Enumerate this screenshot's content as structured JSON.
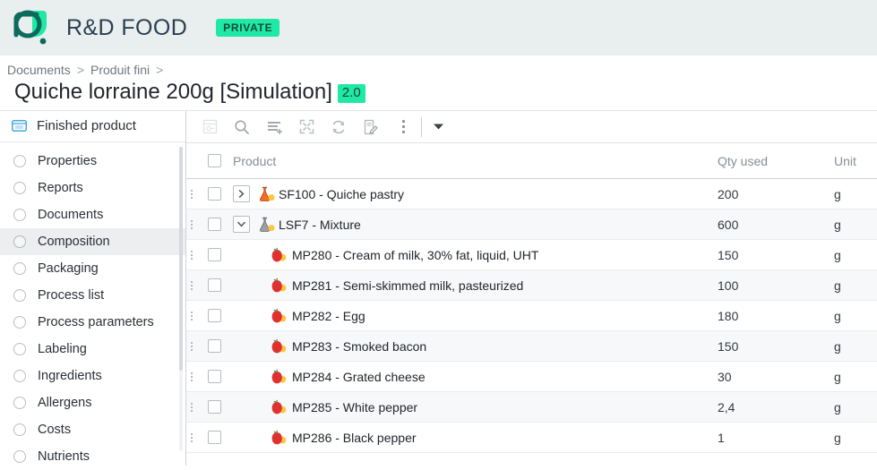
{
  "app": {
    "logo_icon": "leaf-circle-logo",
    "title": "R&D FOOD",
    "privacy_badge": "PRIVATE",
    "brand_color": "#1fe9a4",
    "topbar_bg": "#e9eeee"
  },
  "breadcrumb": {
    "items": [
      "Documents",
      "Produit fini"
    ],
    "separator": ">",
    "trailing_separator": ">"
  },
  "page": {
    "title": "Quiche lorraine 200g [Simulation]",
    "version_badge": "2.0"
  },
  "sidebar": {
    "header": {
      "icon": "folder-icon",
      "label": "Finished product"
    },
    "items": [
      {
        "label": "Properties",
        "active": false
      },
      {
        "label": "Reports",
        "active": false
      },
      {
        "label": "Documents",
        "active": false
      },
      {
        "label": "Composition",
        "active": true
      },
      {
        "label": "Packaging",
        "active": false
      },
      {
        "label": "Process list",
        "active": false
      },
      {
        "label": "Process parameters",
        "active": false
      },
      {
        "label": "Labeling",
        "active": false
      },
      {
        "label": "Ingredients",
        "active": false
      },
      {
        "label": "Allergens",
        "active": false
      },
      {
        "label": "Costs",
        "active": false
      },
      {
        "label": "Nutrients",
        "active": false
      }
    ]
  },
  "toolbar": {
    "buttons": [
      {
        "name": "export-template-button",
        "icon": "document-export-icon",
        "disabled": true
      },
      {
        "name": "search-button",
        "icon": "search-icon",
        "disabled": false
      },
      {
        "name": "add-row-button",
        "icon": "add-list-row-icon",
        "disabled": false
      },
      {
        "name": "fullscreen-button",
        "icon": "expand-fullscreen-icon",
        "disabled": false
      },
      {
        "name": "refresh-button",
        "icon": "refresh-icon",
        "disabled": false
      },
      {
        "name": "edit-button",
        "icon": "edit-document-icon",
        "disabled": false
      },
      {
        "name": "more-options-button",
        "icon": "kebab-menu-icon",
        "disabled": false
      }
    ],
    "dropdown_icon": "chevron-down-icon"
  },
  "table": {
    "columns": {
      "product": "Product",
      "qty": "Qty used",
      "unit": "Unit"
    },
    "rows": [
      {
        "icon": "flask-orange-icon",
        "expander": "chevron-right-icon",
        "level": 0,
        "label": "SF100 - Quiche pastry",
        "qty": "200",
        "unit": "g"
      },
      {
        "icon": "flask-gray-icon",
        "expander": "chevron-down-icon",
        "level": 0,
        "label": "LSF7 - Mixture",
        "qty": "600",
        "unit": "g"
      },
      {
        "icon": "raw-material-icon",
        "expander": null,
        "level": 1,
        "label": "MP280 - Cream of milk, 30% fat, liquid, UHT",
        "qty": "150",
        "unit": "g"
      },
      {
        "icon": "raw-material-icon",
        "expander": null,
        "level": 1,
        "label": "MP281 - Semi-skimmed milk, pasteurized",
        "qty": "100",
        "unit": "g"
      },
      {
        "icon": "raw-material-icon",
        "expander": null,
        "level": 1,
        "label": "MP282 - Egg",
        "qty": "180",
        "unit": "g"
      },
      {
        "icon": "raw-material-icon",
        "expander": null,
        "level": 1,
        "label": "MP283 - Smoked bacon",
        "qty": "150",
        "unit": "g"
      },
      {
        "icon": "raw-material-icon",
        "expander": null,
        "level": 1,
        "label": "MP284 - Grated cheese",
        "qty": "30",
        "unit": "g"
      },
      {
        "icon": "raw-material-icon",
        "expander": null,
        "level": 1,
        "label": "MP285 - White pepper",
        "qty": "2,4",
        "unit": "g"
      },
      {
        "icon": "raw-material-icon",
        "expander": null,
        "level": 1,
        "label": "MP286 - Black pepper",
        "qty": "1",
        "unit": "g"
      }
    ]
  }
}
